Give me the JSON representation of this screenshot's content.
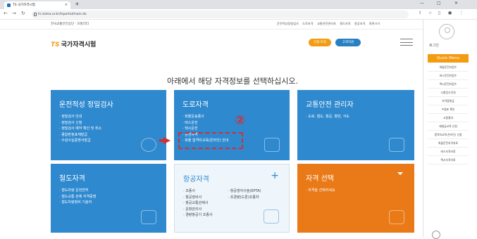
{
  "browser": {
    "tab_title": "TS 국가자격시험",
    "url": "lic.kotsa.or.kr/tsportal/main.do",
    "new_tab": "+",
    "minimize": "—",
    "maximize": "□",
    "close": "✕"
  },
  "utility": {
    "left": "한국교통안전공단 · 모빌리티",
    "links": [
      "운전적성정밀검사",
      "도로자격",
      "교통안전관리자",
      "철도자격",
      "항공자격",
      "화면크기"
    ]
  },
  "header": {
    "logo_ts": "TS",
    "logo_text": "국가자격시험",
    "btn_apply": "신청·조회",
    "btn_customer": "고객지원"
  },
  "main": {
    "heading": "아래에서 해당 자격정보를 선택하십시오."
  },
  "cards": {
    "aptitude": {
      "title": "운전적성 정밀검사",
      "items": [
        "정밀검사 안내",
        "정밀검사 신청",
        "정밀검사 예약 확인 및 취소",
        "종합판정표재발급",
        "수검사실증명서발급"
      ]
    },
    "road": {
      "title": "도로자격",
      "items": [
        "화물운송종사",
        "버스운전",
        "택시운전",
        "운전자격",
        "화물 합격자교육(온라인) 안내"
      ]
    },
    "safety": {
      "title": "교통안전 관리자",
      "items": [
        "도로, 철도, 항공, 항만, 삭도"
      ]
    },
    "rail": {
      "title": "철도자격",
      "items": [
        "철도차량 운전면허",
        "철도교통 관제 자격증명",
        "철도차량정비 기술자"
      ]
    },
    "aviation": {
      "title": "항공자격",
      "plus": "+",
      "col1": [
        "조종사",
        "항공정비사",
        "항공교통관제사",
        "운항관리사",
        "경량항공기 조종사"
      ],
      "col2": [
        "항공영어구술(EPTA)",
        "초경량(드론)조종자"
      ]
    },
    "select": {
      "title": "자격 선택",
      "items": [
        "자격을 선택하세요"
      ]
    }
  },
  "annotation": {
    "marker": "②"
  },
  "sidebar": {
    "login": "로그인",
    "quick_menu": "Quick Menu",
    "items": [
      "화물운전자접수",
      "버스운전자접수",
      "택시운전자접수",
      "시험장소안내",
      "자격증발급",
      "수험표 확인",
      "시험결과",
      "재발급교육 신청",
      "합격자교육(온라인) 신청",
      "화물운전자격자료",
      "버스자격자료",
      "택시자격자료"
    ]
  }
}
